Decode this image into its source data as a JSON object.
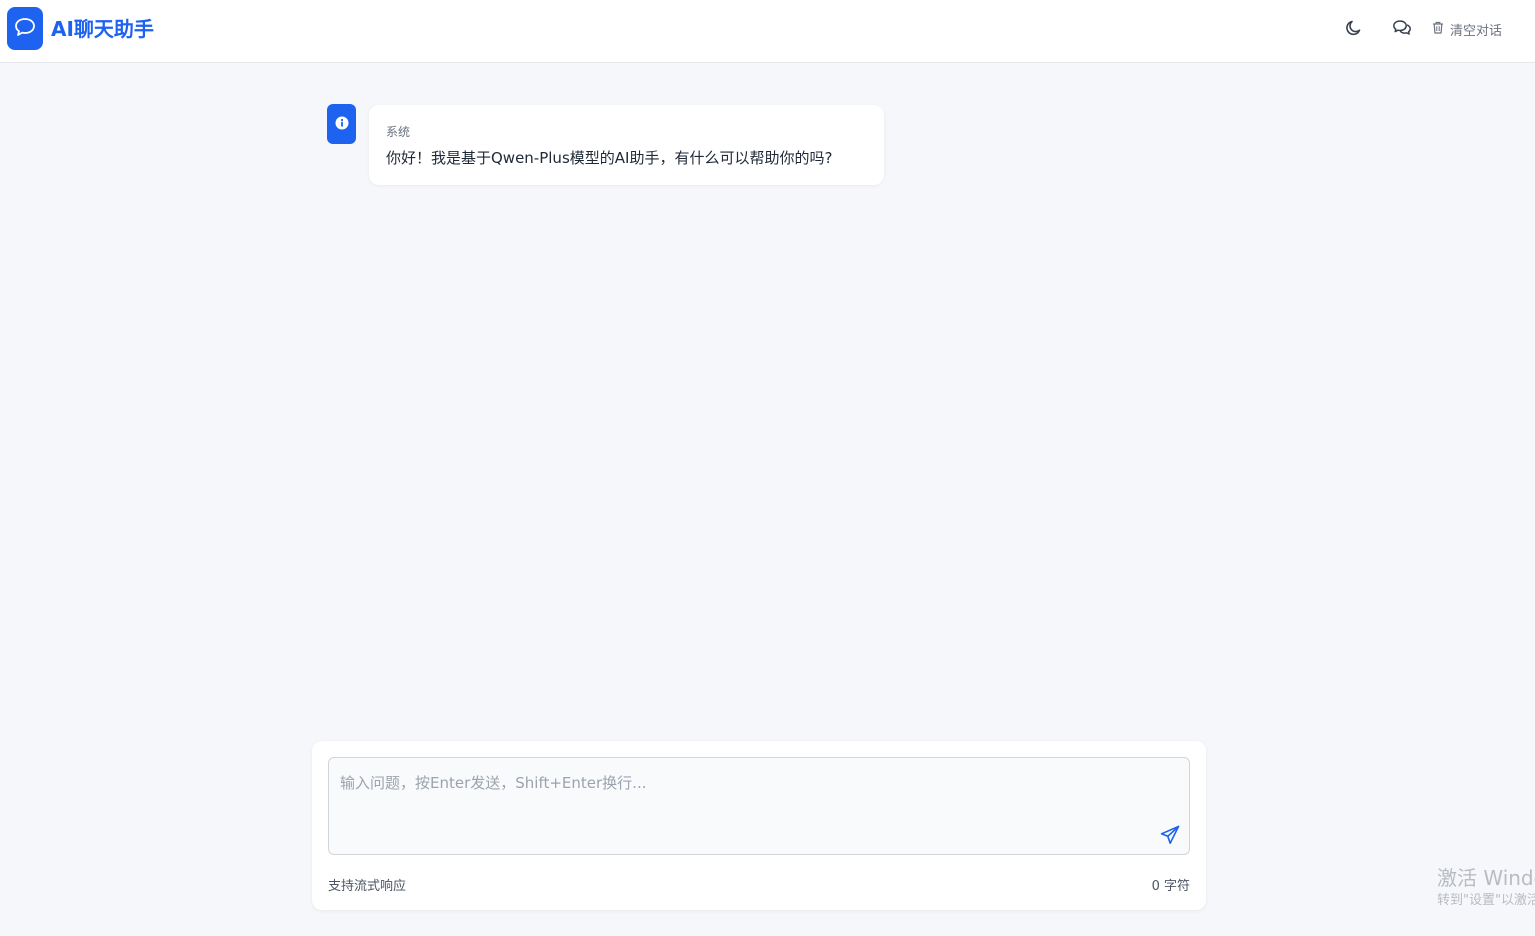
{
  "header": {
    "app_title": "AI聊天助手",
    "logo_icon": "chat-bubble-icon",
    "theme_toggle_icon": "moon-icon",
    "conversations_icon": "chat-bubbles-icon",
    "clear_icon": "trash-icon",
    "clear_label": "清空对话"
  },
  "messages": [
    {
      "sender": "系统",
      "avatar_icon": "info-icon",
      "text": "你好！我是基于Qwen-Plus模型的AI助手，有什么可以帮助你的吗?"
    }
  ],
  "composer": {
    "placeholder": "输入问题，按Enter发送，Shift+Enter换行...",
    "value": "",
    "send_icon": "send-icon",
    "hint": "支持流式响应",
    "char_count": "0 字符"
  },
  "watermark": {
    "title": "激活 Windows",
    "subtitle": "转到\"设置\"以激活 Windows。"
  },
  "colors": {
    "accent": "#1d63f0",
    "background": "#f5f7fa",
    "surface": "#ffffff"
  }
}
